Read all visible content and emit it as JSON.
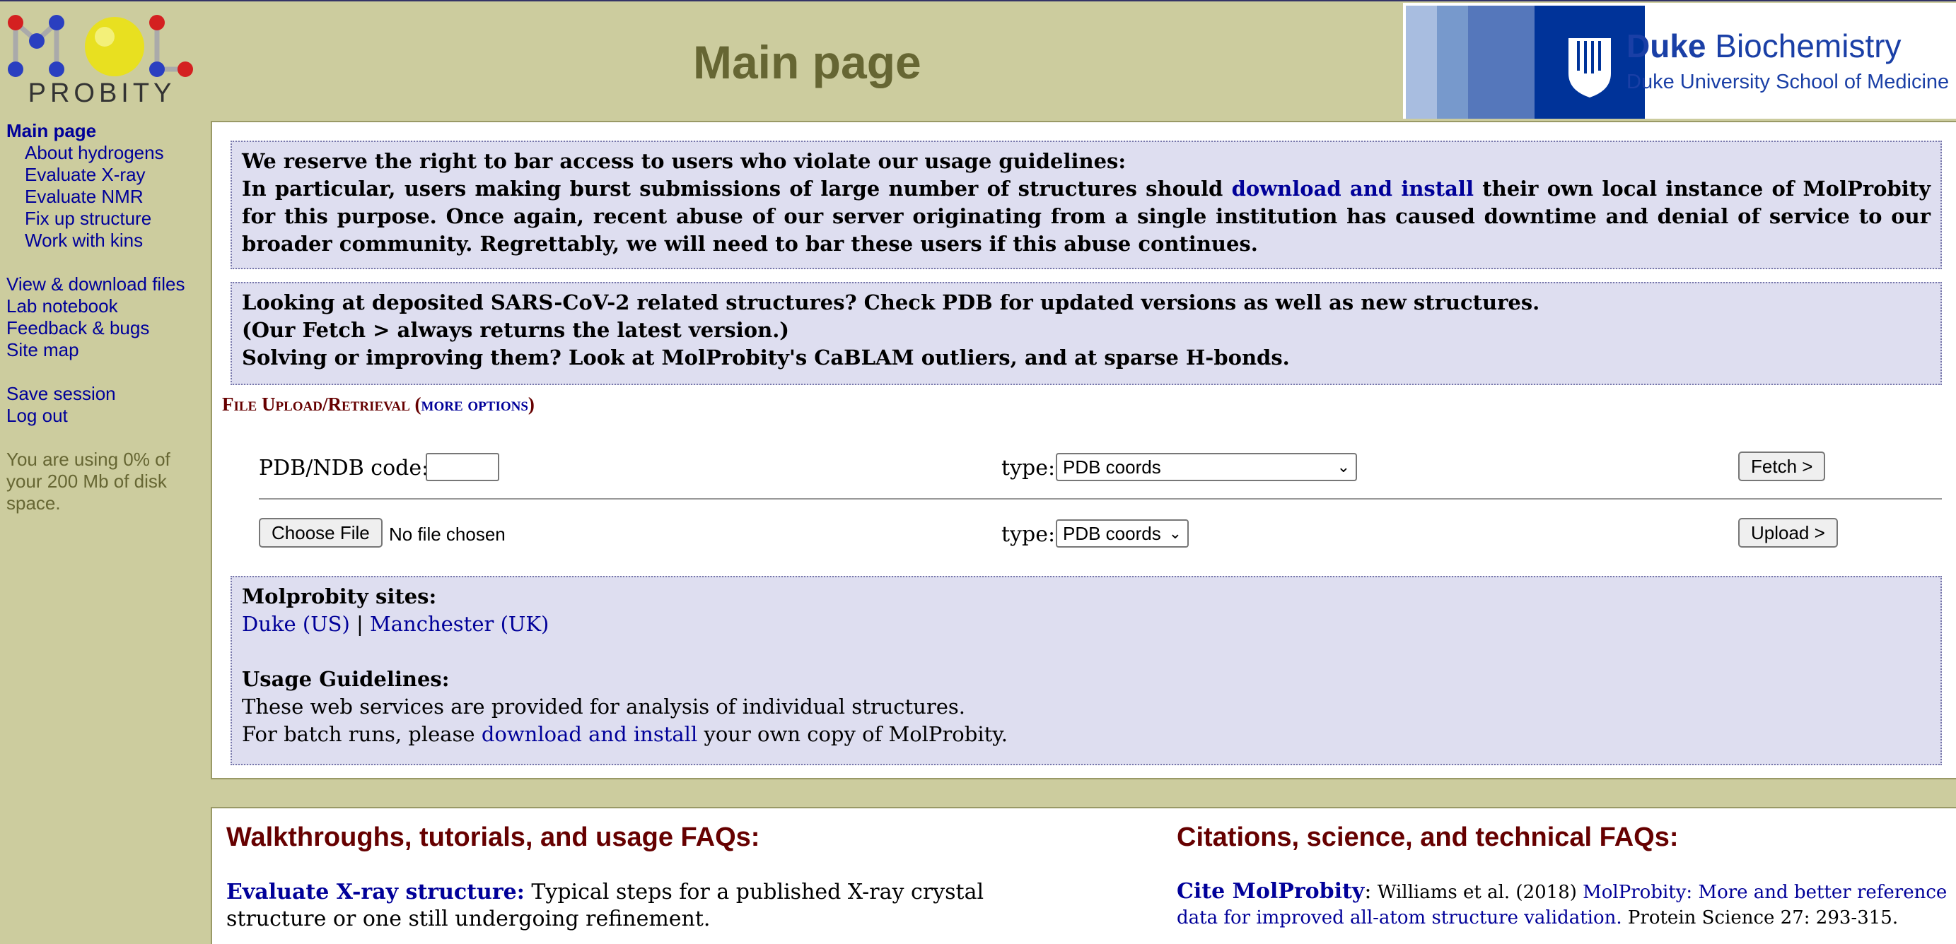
{
  "header": {
    "logo_text": "PROBITY",
    "page_title": "Main page",
    "duke_banner": {
      "brand": "Duke",
      "dept": "Biochemistry",
      "subtitle": "Duke University School of Medicine"
    }
  },
  "sidebar": {
    "main_link": "Main page",
    "sub_links": [
      "About hydrogens",
      "Evaluate X-ray",
      "Evaluate NMR",
      "Fix up structure",
      "Work with kins"
    ],
    "file_links": [
      "View & download files",
      "Lab notebook",
      "Feedback & bugs",
      "Site map"
    ],
    "session_links": [
      "Save session",
      "Log out"
    ],
    "disk_usage": "You are using 0% of your 200 Mb of disk space."
  },
  "notices": {
    "warning_title": "We reserve the right to bar access to users who violate our usage guidelines:",
    "warning_pre": "In particular, users making burst submissions of large number of structures should",
    "warning_link": "download and install",
    "warning_post": "their own local instance of MolProbity for this purpose. Once again, recent abuse of our server originating from a single institution has caused downtime and denial of service to our broader community. Regrettably, we will need to bar these users if this abuse continues.",
    "sars_lines": [
      "Looking at deposited SARS-CoV-2 related structures? Check PDB for updated versions as well as new structures.",
      "(Our Fetch > always returns the latest version.)",
      "Solving or improving them? Look at MolProbity's CaBLAM outliers, and at sparse H-bonds."
    ]
  },
  "upload": {
    "heading": "File Upload/Retrieval",
    "more_options": "more options",
    "fetch_row": {
      "label": "PDB/NDB code:",
      "input_value": "",
      "type_label": "type:",
      "type_value": "PDB coords",
      "button": "Fetch >"
    },
    "upload_row": {
      "choose_button": "Choose File",
      "file_status": "No file chosen",
      "type_label": "type:",
      "type_value": "PDB coords",
      "button": "Upload >"
    }
  },
  "sites": {
    "title": "Molprobity sites:",
    "duke": "Duke (US)",
    "separator": "|",
    "manchester": "Manchester (UK)",
    "guidelines_title": "Usage Guidelines:",
    "guidelines_line1": "These web services are provided for analysis of individual structures.",
    "guidelines_pre": "For batch runs, please",
    "guidelines_link": "download and install",
    "guidelines_post": "your own copy of MolProbity."
  },
  "faq": {
    "left_heading": "Walkthroughs, tutorials, and usage FAQs:",
    "left_link": "Evaluate X-ray structure:",
    "left_text": "Typical steps for a published X-ray crystal structure or one still undergoing refinement.",
    "right_heading": "Citations, science, and technical FAQs:",
    "right_link": "Cite MolProbity",
    "right_colon": ":",
    "right_authors": "Williams et al. (2018)",
    "right_paper": "MolProbity: More and better reference data for improved all-atom structure validation.",
    "right_journal": "Protein Science 27: 293-315."
  },
  "colors": {
    "background": "#cccc9e",
    "link": "#000099",
    "heading_red": "#660000",
    "title_olive": "#666633",
    "notice_bg": "#dedef0",
    "duke_blue": "#003399"
  }
}
